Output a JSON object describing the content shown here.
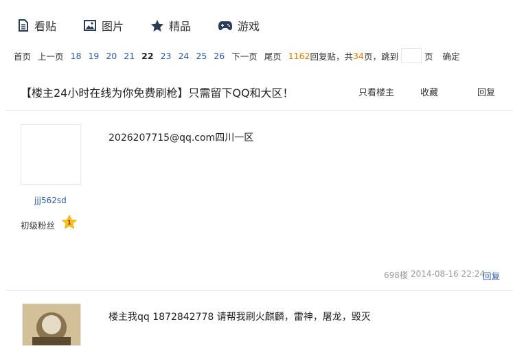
{
  "nav": {
    "tabs": [
      {
        "label": "看贴",
        "icon": "document-icon"
      },
      {
        "label": "图片",
        "icon": "picture-icon"
      },
      {
        "label": "精品",
        "icon": "star-icon"
      },
      {
        "label": "游戏",
        "icon": "gamepad-icon"
      }
    ]
  },
  "pager": {
    "first": "首页",
    "prev": "上一页",
    "pages": [
      "18",
      "19",
      "20",
      "21",
      "22",
      "23",
      "24",
      "25",
      "26"
    ],
    "current": "22",
    "next": "下一页",
    "last": "尾页",
    "reply_count": "1162",
    "reply_suffix": "回复贴，共",
    "page_count": "34",
    "page_suffix": "页，跳到",
    "jump_value": "",
    "page_unit": "页",
    "confirm": "确定"
  },
  "thread": {
    "title": "【楼主24小时在线为你免费刷枪】只需留下QQ和大区！",
    "only_op": "只看楼主",
    "favorite": "收藏",
    "reply": "回复"
  },
  "posts": [
    {
      "username": "jjj562sd",
      "rank": "初级粉丝",
      "level": "1",
      "content": "2026207715@qq.com四川一区",
      "floor": "698楼",
      "time": "2014-08-16 22:24",
      "reply": "回复"
    },
    {
      "content": "楼主我qq 1872842778 请帮我刷火麒麟，雷神，屠龙，毁灭"
    }
  ],
  "colors": {
    "link": "#2a5aa8",
    "orange": "#e07a00",
    "star": "#f7c51b",
    "muted": "#999999"
  }
}
